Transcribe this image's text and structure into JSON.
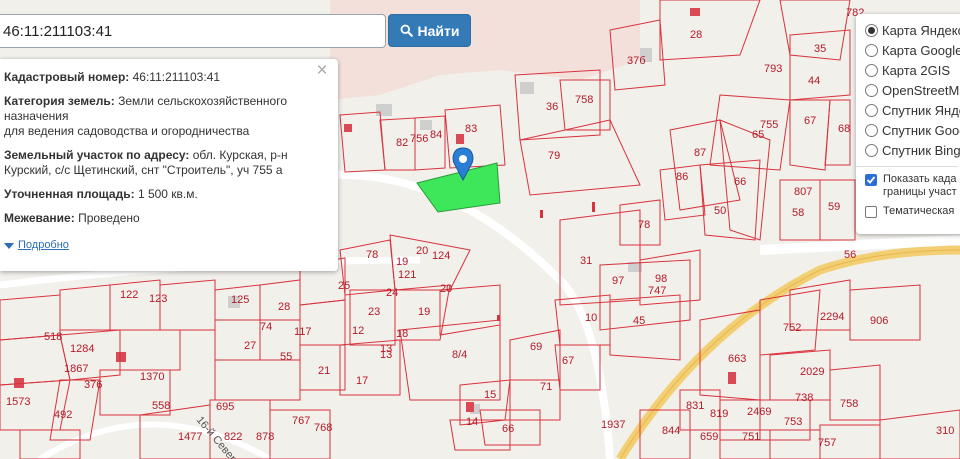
{
  "search": {
    "value": "46:11:211103:41",
    "button_label": "Найти",
    "icon": "search-icon"
  },
  "info_panel": {
    "cadastral_label": "Кадастровый номер:",
    "cadastral_value": "46:11:211103:41",
    "category_label": "Категория земель:",
    "category_value_1": "Земли сельскохозяйственного",
    "category_value_2": "назначения",
    "category_value_3": "для ведения садоводства и огородничества",
    "address_label": "Земельный участок по адресу:",
    "address_value_1": "обл. Курская, р-н",
    "address_value_2": "Курский, с/с Щетинский, снт \"Строитель\", уч 755 а",
    "area_label": "Уточненная площадь:",
    "area_value": "1 500 кв.м.",
    "survey_label": "Межевание:",
    "survey_value": "Проведено",
    "more_link": "Подробно",
    "close_icon": "close-icon"
  },
  "layers_panel": {
    "options": [
      {
        "label": "Карта Яндекс",
        "selected": true
      },
      {
        "label": "Карта Google",
        "selected": false
      },
      {
        "label": "Карта 2GIS",
        "selected": false
      },
      {
        "label": "OpenStreetMap",
        "selected": false
      },
      {
        "label": "Спутник Яндекс",
        "selected": false
      },
      {
        "label": "Спутник Google",
        "selected": false
      },
      {
        "label": "Спутник Bing",
        "selected": false
      }
    ],
    "show_cadastral_1": "Показать када",
    "show_cadastral_2": "границы участ",
    "show_cadastral_checked": true,
    "thematic_label": "Тематическая",
    "thematic_checked": false
  },
  "map": {
    "colors": {
      "parcel_border": "#d8323c",
      "highlight_fill": "#3ee65a",
      "road_fill": "#f3cf73",
      "marker": "#2a7fd4",
      "building": "#c8c8c8"
    },
    "parcel_labels": [
      "782",
      "28",
      "35",
      "793",
      "44",
      "37б",
      "36",
      "758",
      "755",
      "65",
      "67",
      "68",
      "79",
      "82",
      "756",
      "84",
      "83",
      "87",
      "86",
      "66",
      "807",
      "58",
      "59",
      "50",
      "78",
      "31",
      "97",
      "98",
      "747",
      "45",
      "10",
      "20",
      "124",
      "19",
      "121",
      "24",
      "20",
      "19",
      "13",
      "78",
      "122",
      "123",
      "125",
      "25",
      "28",
      "74",
      "117",
      "12",
      "23",
      "18",
      "13",
      "27",
      "55",
      "21",
      "17",
      "8/4",
      "69",
      "67",
      "71",
      "15",
      "14",
      "66",
      "56",
      "752",
      "2294",
      "906",
      "663",
      "2029",
      "738",
      "758",
      "831",
      "819",
      "2469",
      "753",
      "844",
      "659",
      "751",
      "757",
      "1937",
      "310",
      "518",
      "1867",
      "1573",
      "492",
      "376",
      "1370",
      "558",
      "1477",
      "695",
      "822",
      "878",
      "767",
      "768",
      "1284"
    ],
    "street_label": "16-й Северный"
  }
}
